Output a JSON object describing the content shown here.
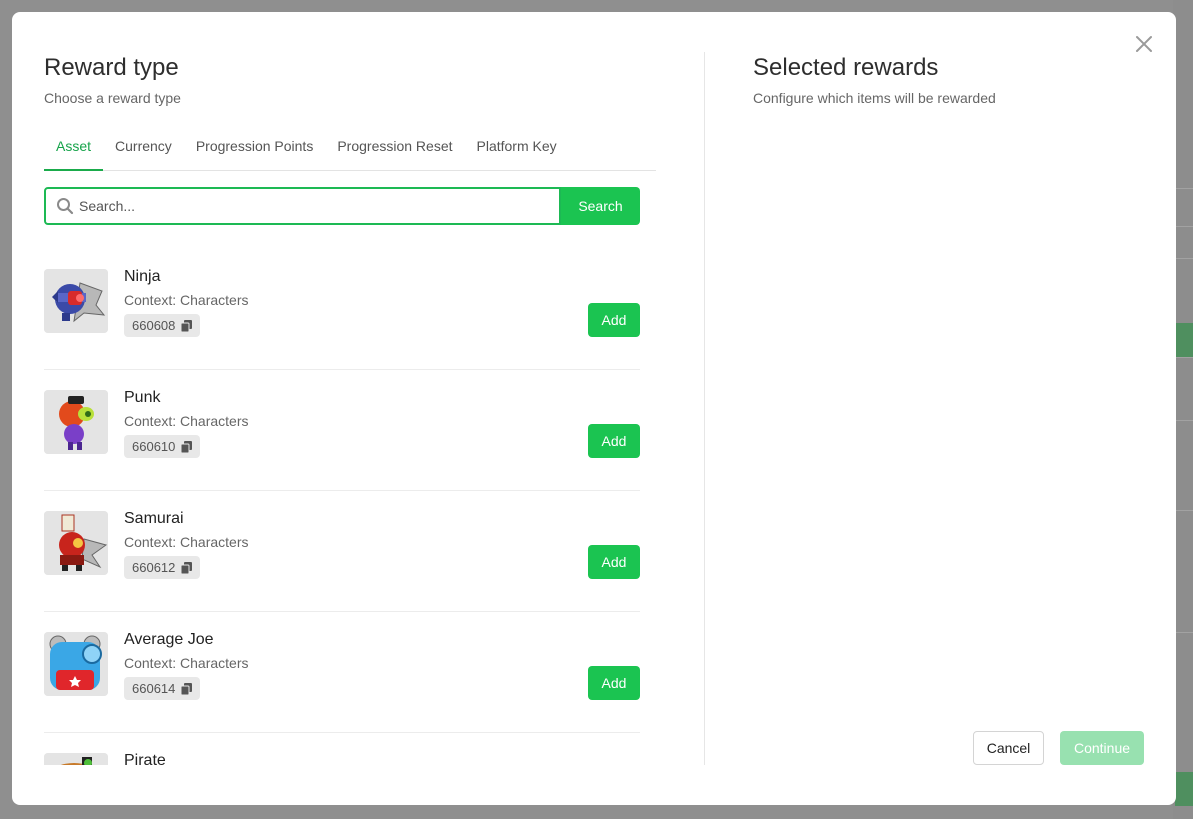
{
  "left_panel": {
    "title": "Reward type",
    "subtitle": "Choose a reward type",
    "tabs": [
      {
        "label": "Asset",
        "active": true
      },
      {
        "label": "Currency",
        "active": false
      },
      {
        "label": "Progression Points",
        "active": false
      },
      {
        "label": "Progression Reset",
        "active": false
      },
      {
        "label": "Platform Key",
        "active": false
      }
    ],
    "search": {
      "placeholder": "Search...",
      "value": "",
      "button_label": "Search"
    },
    "items": [
      {
        "name": "Ninja",
        "context": "Context: Characters",
        "id": "660608",
        "add_label": "Add",
        "icon": "ninja-character-icon"
      },
      {
        "name": "Punk",
        "context": "Context: Characters",
        "id": "660610",
        "add_label": "Add",
        "icon": "punk-character-icon"
      },
      {
        "name": "Samurai",
        "context": "Context: Characters",
        "id": "660612",
        "add_label": "Add",
        "icon": "samurai-character-icon"
      },
      {
        "name": "Average Joe",
        "context": "Context: Characters",
        "id": "660614",
        "add_label": "Add",
        "icon": "average-joe-character-icon"
      },
      {
        "name": "Pirate",
        "context": "",
        "id": "",
        "add_label": "",
        "icon": "pirate-character-icon"
      }
    ]
  },
  "right_panel": {
    "title": "Selected rewards",
    "subtitle": "Configure which items will be rewarded"
  },
  "footer": {
    "cancel_label": "Cancel",
    "continue_label": "Continue"
  },
  "colors": {
    "accent": "#1bc451",
    "accent_disabled": "#98e1b0",
    "tab_active": "#16a34a"
  }
}
